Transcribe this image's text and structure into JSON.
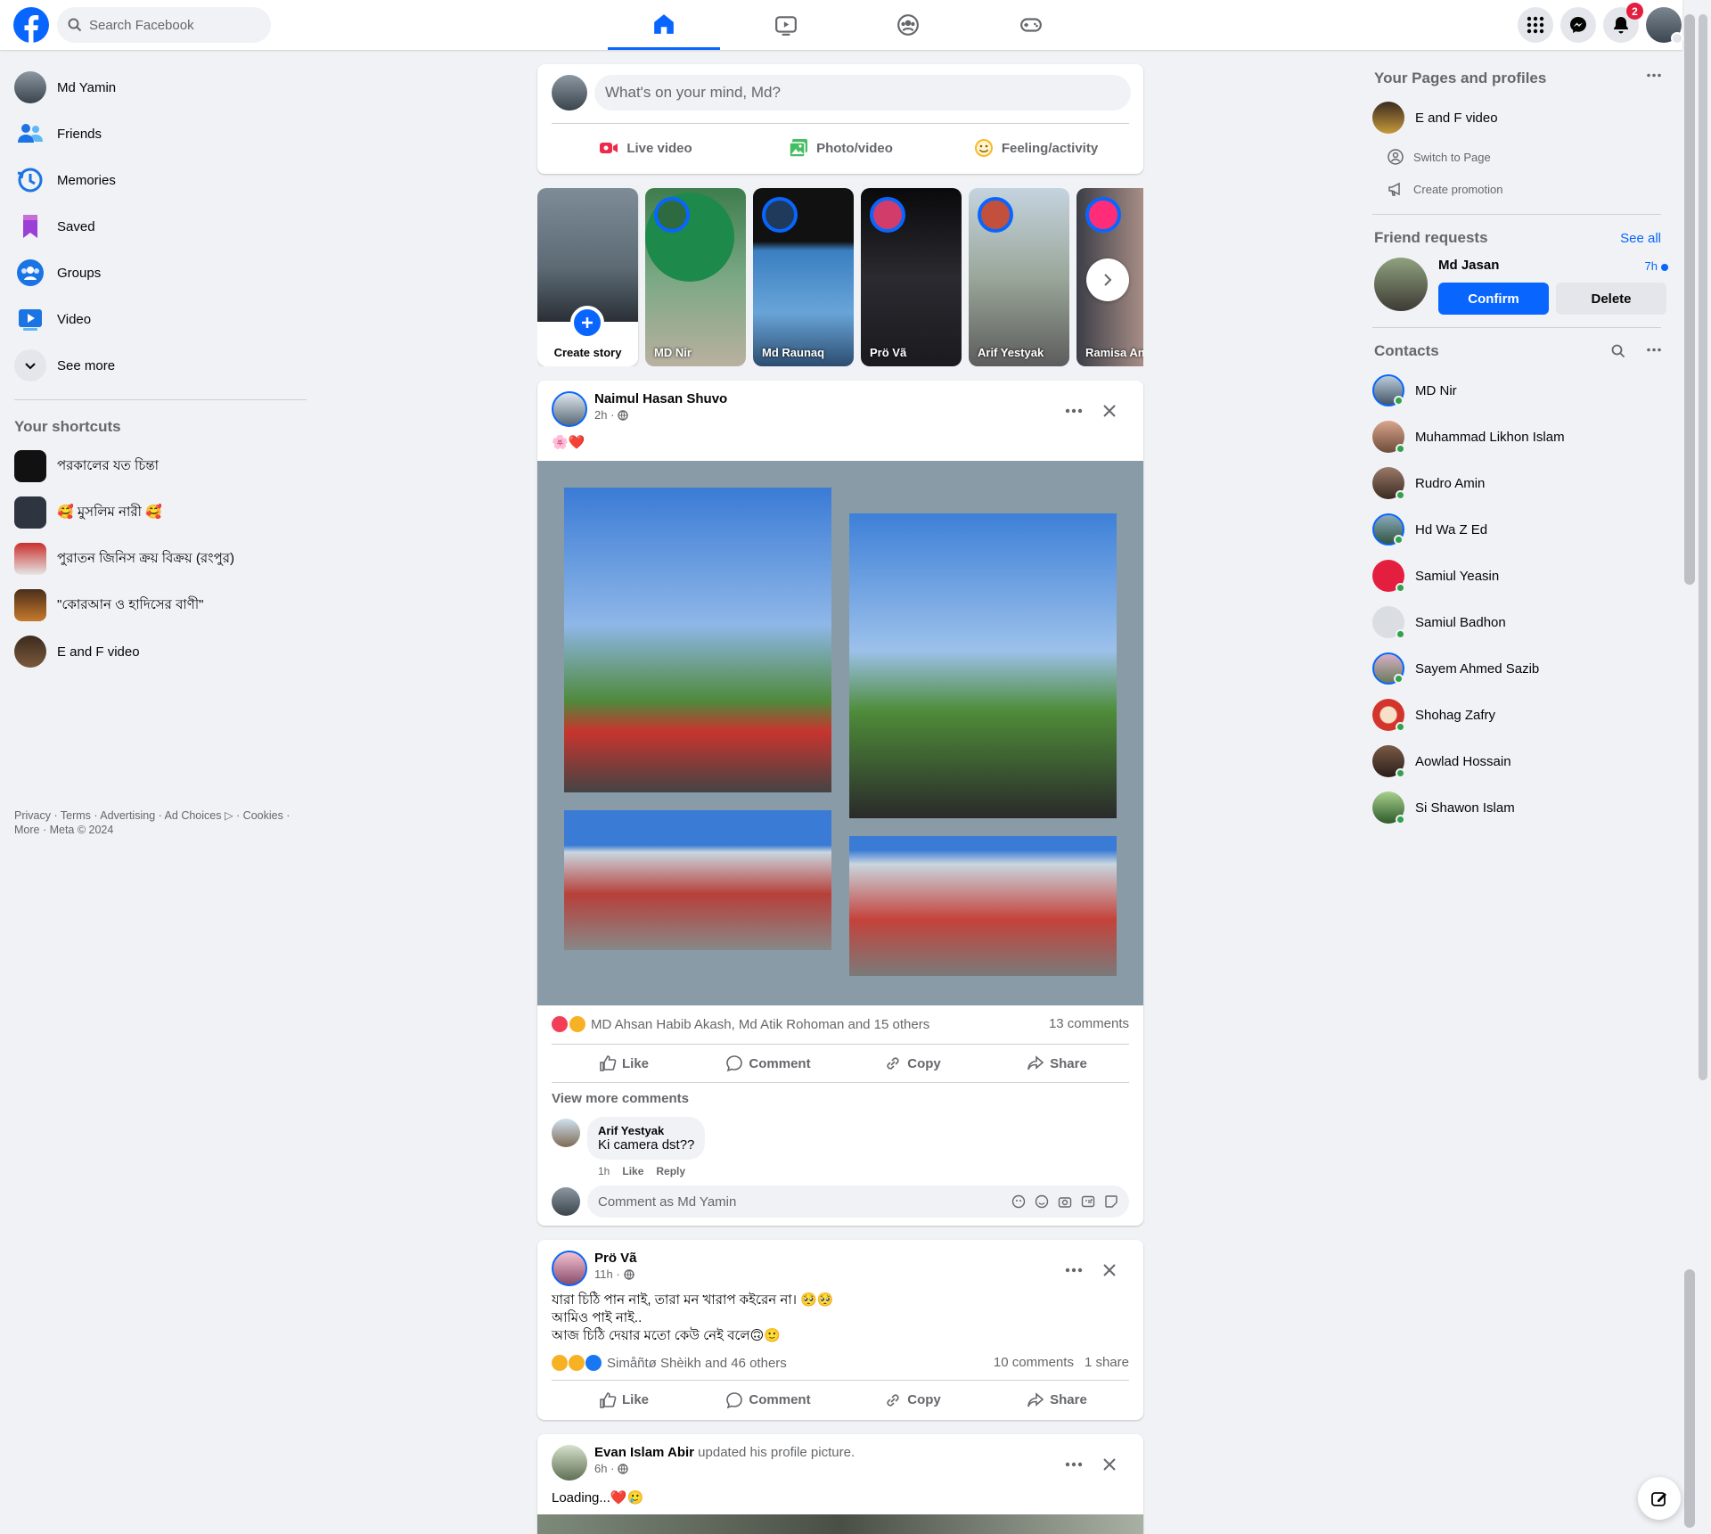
{
  "header": {
    "search_placeholder": "Search Facebook",
    "notifications_count": "2"
  },
  "left_nav": {
    "items": [
      {
        "label": "Md Yamin"
      },
      {
        "label": "Friends"
      },
      {
        "label": "Memories"
      },
      {
        "label": "Saved"
      },
      {
        "label": "Groups"
      },
      {
        "label": "Video"
      },
      {
        "label": "See more"
      }
    ],
    "shortcuts_title": "Your shortcuts",
    "shortcuts": [
      {
        "label": "পরকালের যত চিন্তা"
      },
      {
        "label": "🥰 মুসলিম নারী 🥰"
      },
      {
        "label": "পুরাতন জিনিস ক্রয় বিক্রয় (রংপুর)"
      },
      {
        "label": "\"কোরআন ও হাদিসের বাণী\""
      },
      {
        "label": "E and F video"
      }
    ],
    "footer": "Privacy · Terms · Advertising · Ad Choices ▷ · Cookies · More · Meta © 2024"
  },
  "composer": {
    "placeholder": "What's on your mind, Md?",
    "live": "Live video",
    "photo": "Photo/video",
    "feeling": "Feeling/activity"
  },
  "stories": {
    "create_label": "Create story",
    "items": [
      {
        "name": "MD Nir"
      },
      {
        "name": "Md Raunaq"
      },
      {
        "name": "Prö Vã"
      },
      {
        "name": "Arif Yestyak"
      },
      {
        "name": "Ramisa Anj"
      }
    ]
  },
  "post1": {
    "author": "Naimul Hasan Shuvo",
    "time": "2h ·",
    "text": "🌸❤️",
    "reactions": "MD Ahsan Habib Akash, Md Atik Rohoman and 15 others",
    "comments_count": "13 comments",
    "like": "Like",
    "comment": "Comment",
    "copy": "Copy",
    "share": "Share",
    "view_more": "View more comments",
    "c_author": "Arif Yestyak",
    "c_text": "Ki camera dst??",
    "c_time": "1h",
    "c_like": "Like",
    "c_reply": "Reply",
    "comment_placeholder": "Comment as Md Yamin"
  },
  "post2": {
    "author": "Prö Vã",
    "time": "11h ·",
    "line1": "যারা চিঠি পান নাই, তারা মন খারাপ কইরেন না। 🥺🥺",
    "line2": "আমিও পাই নাই..",
    "line3": "আজ চিঠি দেয়ার মতো কেউ নেই বলে🙃🙂",
    "reactions": "Simåñtø Shèikh and 46 others",
    "comments_count": "10 comments",
    "shares": "1 share",
    "like": "Like",
    "comment": "Comment",
    "copy": "Copy",
    "share": "Share"
  },
  "post3": {
    "author": "Evan Islam Abir",
    "action": "updated his profile picture.",
    "time": "6h ·",
    "text": "Loading...❤️🥲"
  },
  "right": {
    "pages_title": "Your Pages and profiles",
    "page_name": "E and F video",
    "switch": "Switch to Page",
    "promo": "Create promotion",
    "fr_title": "Friend requests",
    "see_all": "See all",
    "fr_name": "Md Jasan",
    "fr_time": "7h",
    "confirm": "Confirm",
    "delete": "Delete",
    "contacts_title": "Contacts",
    "contacts": [
      {
        "name": "MD Nir"
      },
      {
        "name": "Muhammad Likhon Islam"
      },
      {
        "name": "Rudro Amin"
      },
      {
        "name": "Hd Wa Z Ed"
      },
      {
        "name": "Samiul Yeasin"
      },
      {
        "name": "Samiul Badhon"
      },
      {
        "name": "Sayem Ahmed Sazib"
      },
      {
        "name": "Shohag Zafry"
      },
      {
        "name": "Aowlad Hossain"
      },
      {
        "name": "Si Shawon Islam"
      }
    ]
  },
  "colors": {
    "brand": "#0866ff",
    "bg": "#f0f2f5",
    "text_secondary": "#65676b"
  }
}
